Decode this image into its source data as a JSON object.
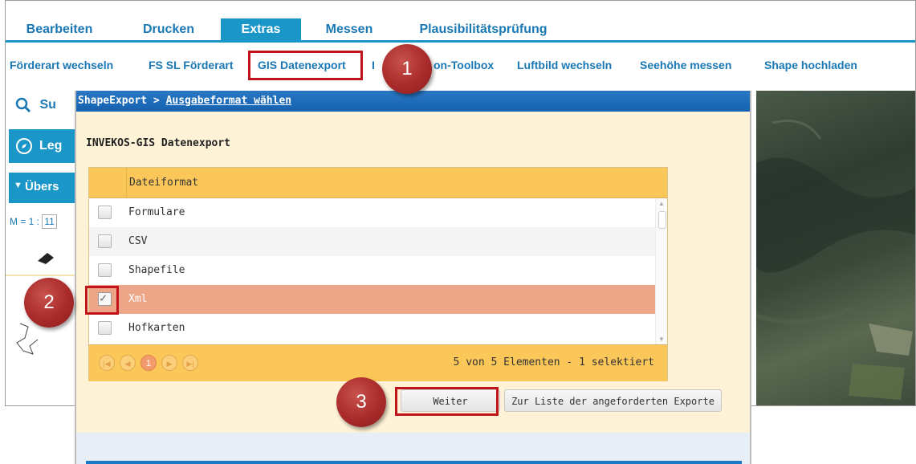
{
  "tabs": [
    "Bearbeiten",
    "Drucken",
    "Extras",
    "Messen",
    "Plausibilitätsprüfung"
  ],
  "subnav": [
    "Förderart wechseln",
    "FS SL Förderart",
    "GIS Datenexport",
    "I",
    "on-Toolbox",
    "Luftbild wechseln",
    "Seehöhe messen",
    "Shape hochladen"
  ],
  "left": {
    "search": "Su",
    "legend": "Leg",
    "uebersicht": "Übers",
    "scale_prefix": "M = 1 :",
    "scale_value": "11"
  },
  "dialog": {
    "title_prefix": "ShapeExport >",
    "title_link": "Ausgabeformat wählen",
    "heading": "INVEKOS-GIS Datenexport",
    "column_header": "Dateiformat",
    "rows": [
      "Formulare",
      "CSV",
      "Shapefile",
      "Xml",
      "Hofkarten"
    ],
    "selected_row": "Xml",
    "page_current": "1",
    "pager_info": "5 von 5 Elementen - 1 selektiert",
    "next_button": "Weiter",
    "list_button": "Zur Liste der angeforderten Exporte"
  },
  "badges": [
    "1",
    "2",
    "3"
  ],
  "colors": {
    "accent_blue": "#1a96c8",
    "highlight_red": "#c0141a",
    "grid_header": "#fcc759",
    "selected_row": "#eea688"
  }
}
